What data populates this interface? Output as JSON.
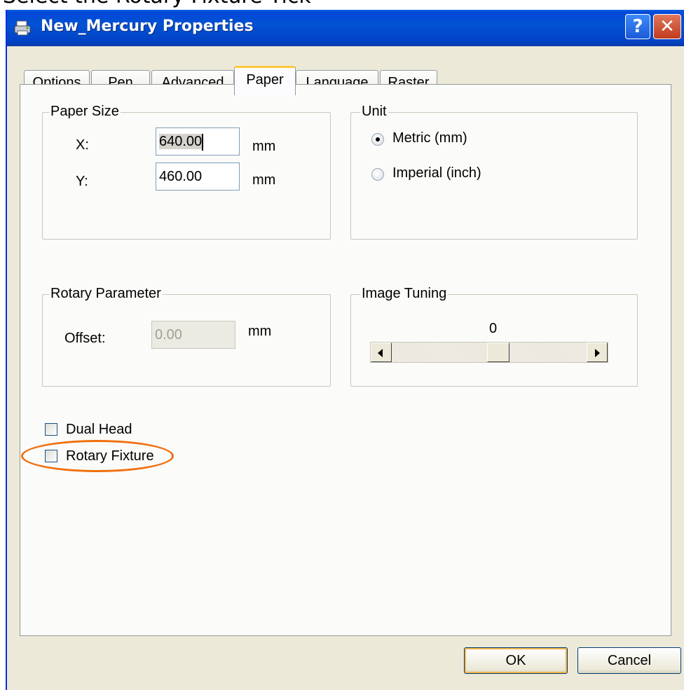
{
  "caption": "Select the Rotary Fixture Tick",
  "window": {
    "title": "New_Mercury Properties",
    "help_label": "?",
    "close_label": "✕"
  },
  "tabs": [
    {
      "label": "Options"
    },
    {
      "label": "Pen"
    },
    {
      "label": "Advanced"
    },
    {
      "label": "Paper",
      "active": true
    },
    {
      "label": "Language"
    },
    {
      "label": "Raster"
    }
  ],
  "paper_size": {
    "legend": "Paper Size",
    "x_label": "X:",
    "x_value": "640.00",
    "x_unit": "mm",
    "y_label": "Y:",
    "y_value": "460.00",
    "y_unit": "mm"
  },
  "unit": {
    "legend": "Unit",
    "options": [
      {
        "label": "Metric (mm)",
        "selected": true
      },
      {
        "label": "Imperial (inch)",
        "selected": false
      }
    ]
  },
  "rotary_parameter": {
    "legend": "Rotary Parameter",
    "offset_label": "Offset:",
    "offset_value": "0.00",
    "offset_unit": "mm"
  },
  "image_tuning": {
    "legend": "Image Tuning",
    "value": "0"
  },
  "checkboxes": [
    {
      "label": "Dual Head",
      "checked": false
    },
    {
      "label": "Rotary Fixture",
      "checked": false
    }
  ],
  "buttons": {
    "ok": "OK",
    "cancel": "Cancel"
  },
  "colors": {
    "title_bar": "#0252d3",
    "annotation": "#f07010",
    "dialog_bg": "#ece9d8"
  }
}
